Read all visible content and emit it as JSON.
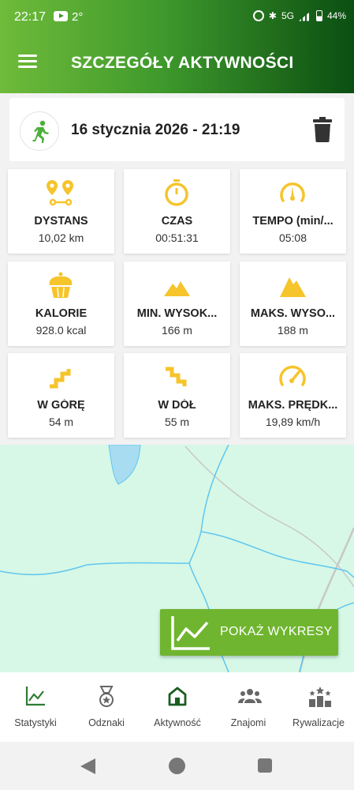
{
  "status_bar": {
    "time": "22:17",
    "temperature": "2°",
    "battery": "44%",
    "network": "5G"
  },
  "header": {
    "title": "SZCZEGÓŁY AKTYWNOŚCI"
  },
  "activity": {
    "date": "16 stycznia 2026 - 21:19",
    "type_icon": "running-person-icon"
  },
  "stats": [
    {
      "label": "DYSTANS",
      "value": "10,02 km",
      "icon": "route-pins-icon"
    },
    {
      "label": "CZAS",
      "value": "00:51:31",
      "icon": "stopwatch-icon"
    },
    {
      "label": "TEMPO (min/...",
      "value": "05:08",
      "icon": "speedometer-icon"
    },
    {
      "label": "KALORIE",
      "value": "928.0 kcal",
      "icon": "cupcake-icon"
    },
    {
      "label": "MIN. WYSOK...",
      "value": "166 m",
      "icon": "low-mountain-icon"
    },
    {
      "label": "MAKS. WYSO...",
      "value": "188 m",
      "icon": "high-mountain-icon"
    },
    {
      "label": "W GÓRĘ",
      "value": "54 m",
      "icon": "stairs-up-icon"
    },
    {
      "label": "W DÓŁ",
      "value": "55 m",
      "icon": "stairs-down-icon"
    },
    {
      "label": "MAKS. PRĘDK...",
      "value": "19,89 km/h",
      "icon": "gauge-icon"
    }
  ],
  "map": {
    "chart_button_label": "POKAŻ WYKRESY"
  },
  "bottom_nav": [
    {
      "label": "Statystyki",
      "icon": "line-chart-icon",
      "active": false
    },
    {
      "label": "Odznaki",
      "icon": "medal-icon",
      "active": false
    },
    {
      "label": "Aktywność",
      "icon": "home-icon",
      "active": true
    },
    {
      "label": "Znajomi",
      "icon": "friends-icon",
      "active": false
    },
    {
      "label": "Rywalizacje",
      "icon": "podium-icon",
      "active": false
    }
  ],
  "colors": {
    "accent_green": "#6fb52f",
    "icon_yellow": "#f6c42b",
    "map_bg": "#d7f8e6",
    "river": "#5fc6f0"
  }
}
